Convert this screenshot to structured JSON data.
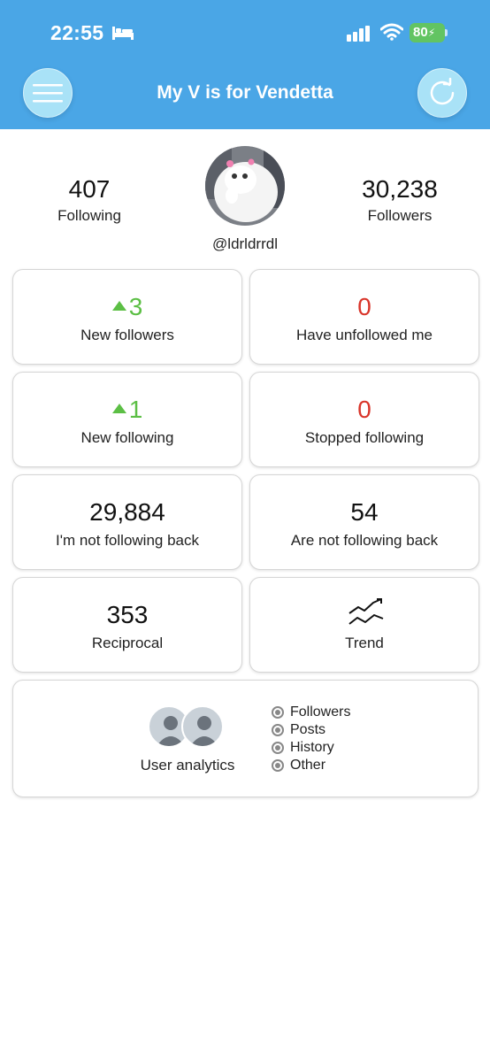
{
  "status_bar": {
    "time": "22:55",
    "battery": "80"
  },
  "header": {
    "title": "My V is for Vendetta",
    "background_color": "#4aa6e6",
    "menu_icon": "hamburger-menu-icon",
    "refresh_icon": "refresh-icon"
  },
  "profile": {
    "following_count": "407",
    "following_label": "Following",
    "followers_count": "30,238",
    "followers_label": "Followers",
    "username": "@ldrldrrdl"
  },
  "cards": {
    "new_followers": {
      "value": "3",
      "label": "New followers",
      "trend": "up",
      "color": "#5cbf45"
    },
    "unfollowed_me": {
      "value": "0",
      "label": "Have unfollowed me",
      "color": "#d9362b"
    },
    "new_following": {
      "value": "1",
      "label": "New following",
      "trend": "up",
      "color": "#5cbf45"
    },
    "stopped_following": {
      "value": "0",
      "label": "Stopped following",
      "color": "#d9362b"
    },
    "not_following_back_me": {
      "value": "29,884",
      "label": "I'm not following back"
    },
    "not_following_back_them": {
      "value": "54",
      "label": "Are not following back"
    },
    "reciprocal": {
      "value": "353",
      "label": "Reciprocal"
    },
    "trend": {
      "label": "Trend",
      "icon": "trend-chart-icon"
    }
  },
  "analytics": {
    "label": "User analytics",
    "options": [
      "Followers",
      "Posts",
      "History",
      "Other"
    ]
  }
}
